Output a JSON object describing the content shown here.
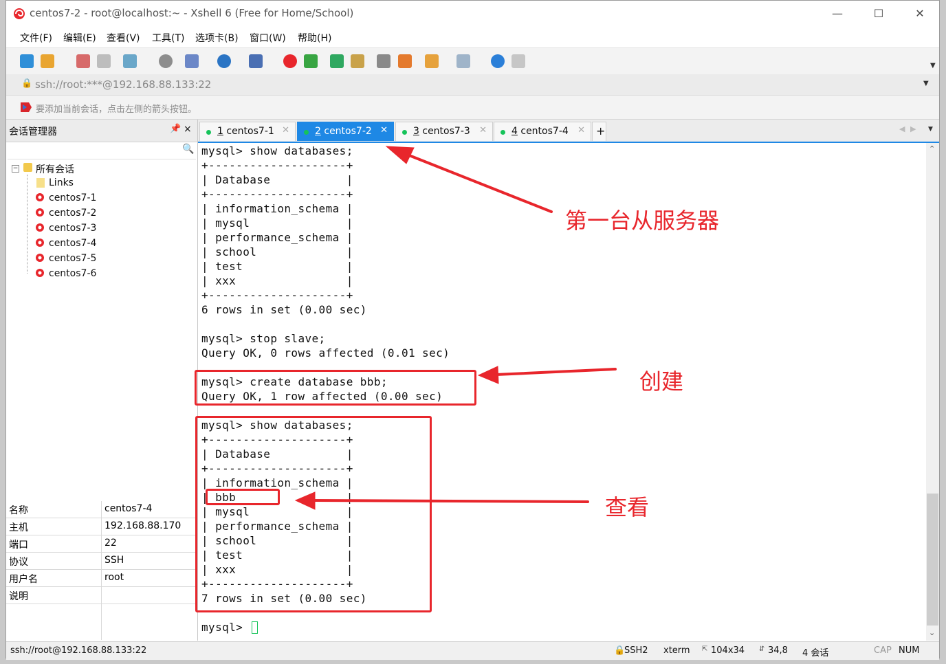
{
  "window": {
    "title": "centos7-2 - root@localhost:~ - Xshell 6 (Free for Home/School)"
  },
  "menu": [
    "文件(F)",
    "编辑(E)",
    "查看(V)",
    "工具(T)",
    "选项卡(B)",
    "窗口(W)",
    "帮助(H)"
  ],
  "address": "ssh://root:***@192.168.88.133:22",
  "hint": "要添加当前会话，点击左侧的箭头按钮。",
  "sidebar": {
    "title": "会话管理器",
    "pin": "ᵖ",
    "close": "×",
    "root": "所有会话",
    "items": [
      "Links",
      "centos7-1",
      "centos7-2",
      "centos7-3",
      "centos7-4",
      "centos7-5",
      "centos7-6"
    ]
  },
  "properties": [
    {
      "key": "名称",
      "value": "centos7-4"
    },
    {
      "key": "主机",
      "value": "192.168.88.170"
    },
    {
      "key": "端口",
      "value": "22"
    },
    {
      "key": "协议",
      "value": "SSH"
    },
    {
      "key": "用户名",
      "value": "root"
    },
    {
      "key": "说明",
      "value": ""
    }
  ],
  "tabs": [
    {
      "num": "1",
      "name": "centos7-1",
      "active": false
    },
    {
      "num": "2",
      "name": "centos7-2",
      "active": true
    },
    {
      "num": "3",
      "name": "centos7-3",
      "active": false
    },
    {
      "num": "4",
      "name": "centos7-4",
      "active": false
    }
  ],
  "terminal": {
    "lines": [
      "mysql> show databases;",
      "+--------------------+",
      "| Database           |",
      "+--------------------+",
      "| information_schema |",
      "| mysql              |",
      "| performance_schema |",
      "| school             |",
      "| test               |",
      "| xxx                |",
      "+--------------------+",
      "6 rows in set (0.00 sec)",
      "",
      "mysql> stop slave;",
      "Query OK, 0 rows affected (0.01 sec)",
      "",
      "mysql> create database bbb;",
      "Query OK, 1 row affected (0.00 sec)",
      "",
      "mysql> show databases;",
      "+--------------------+",
      "| Database           |",
      "+--------------------+",
      "| information_schema |",
      "| bbb                |",
      "| mysql              |",
      "| performance_schema |",
      "| school             |",
      "| test               |",
      "| xxx                |",
      "+--------------------+",
      "7 rows in set (0.00 sec)",
      "",
      "mysql> "
    ]
  },
  "annotations": {
    "first": "第一台从服务器",
    "create": "创建",
    "view": "查看"
  },
  "status": {
    "conn": "ssh://root@192.168.88.133:22",
    "proto": "SSH2",
    "term": "xterm",
    "size": "104x34",
    "pos": "34,8",
    "sessions": "4 会话",
    "cap": "CAP",
    "num": "NUM"
  },
  "colors": {
    "accent": "#1e88e5",
    "annotation": "#e8262c",
    "online": "#16c35a"
  }
}
